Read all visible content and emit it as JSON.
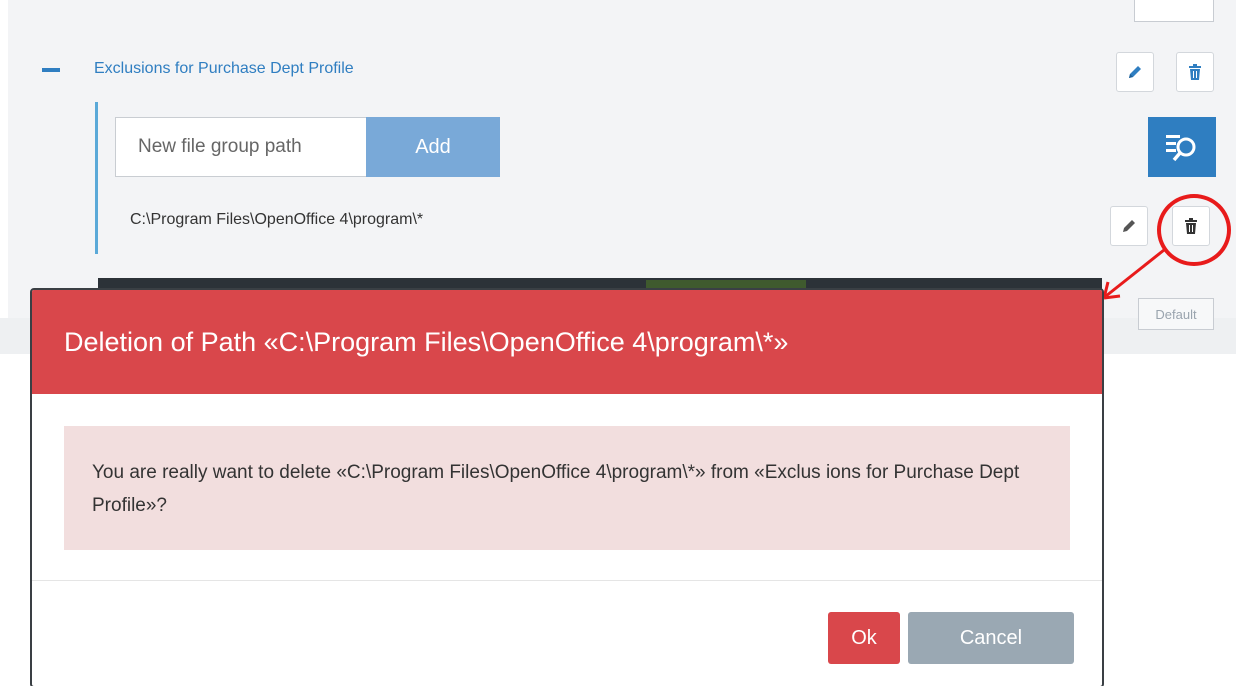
{
  "group": {
    "title": "Exclusions for Purchase Dept Profile"
  },
  "path_form": {
    "placeholder": "New file group path",
    "add_label": "Add"
  },
  "path_item": {
    "text": "C:\\Program Files\\OpenOffice 4\\program\\*"
  },
  "background": {
    "default_label": "Default"
  },
  "modal": {
    "title": "Deletion of Path «C:\\Program Files\\OpenOffice 4\\program\\*»",
    "message": "You are really want to delete «C:\\Program Files\\OpenOffice 4\\program\\*» from «Exclus ions for Purchase Dept Profile»?",
    "ok_label": "Ok",
    "cancel_label": "Cancel"
  },
  "colors": {
    "accent_blue": "#2f7ec1",
    "danger_red": "#d9474b",
    "alert_bg": "#f2dede",
    "cancel_gray": "#9aa8b3",
    "annotation_red": "#e81b1b"
  },
  "icons": {
    "edit": "pencil-icon",
    "delete": "trash-icon",
    "search": "filter-search-icon",
    "collapse": "minus-icon"
  }
}
